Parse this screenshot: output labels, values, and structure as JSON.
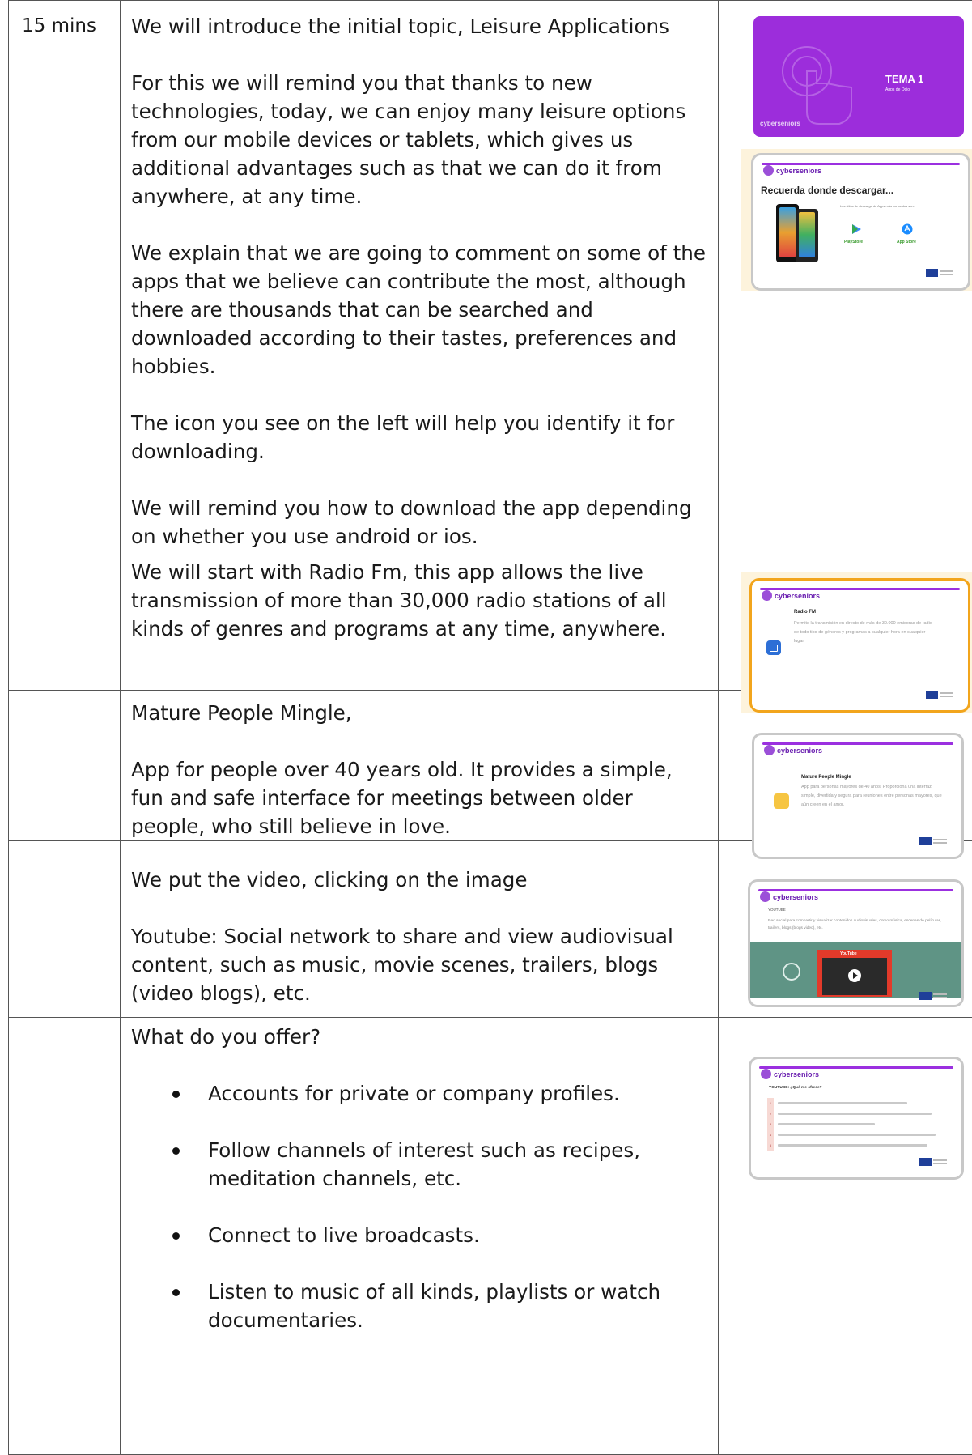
{
  "rows": [
    {
      "time": "15 mins",
      "paragraphs": [
        "We will introduce the initial topic, Leisure Applications",
        "For this we will remind you that thanks to new technologies, today, we can enjoy many leisure options from our mobile devices or tablets, which gives us additional advantages such as that we can do it from anywhere, at any time.",
        "We explain that we are going to comment on some of the apps that we believe can contribute the most, although there are thousands that can be searched and downloaded according to their tastes, preferences and hobbies.",
        "The icon you see on the left will help you identify it for downloading.",
        "We will remind you how to download the app depending on whether you use android or ios."
      ]
    },
    {
      "time": "",
      "paragraphs": [
        "We will start with Radio Fm, this app allows the live transmission of more than 30,000 radio stations of all kinds of genres and programs at any time, anywhere."
      ]
    },
    {
      "time": "",
      "paragraphs": [
        "Mature People Mingle,",
        "App for people over 40 years old. It provides a simple, fun and safe interface for meetings between older people, who still believe in love."
      ]
    },
    {
      "time": "",
      "paragraphs": [
        "We put the video, clicking on the image",
        "Youtube: Social network to share and view audiovisual content, such as music, movie scenes, trailers, blogs (video blogs), etc."
      ]
    },
    {
      "time": "",
      "intro": "What do you offer?",
      "bullets": [
        "Accounts for private or company profiles.",
        "Follow channels of interest such as recipes, meditation channels, etc.",
        "Connect to live broadcasts.",
        "Listen to music of all kinds, playlists or watch documentaries."
      ]
    }
  ],
  "slides": {
    "s1": {
      "title": "TEMA 1",
      "subtitle": "Apps de Ocio",
      "brand": "cyberseniors"
    },
    "s2": {
      "brand": "cyberseniors",
      "title": "Recuerda donde descargar...",
      "caption": "Los sitios de descarga de Apps más conocidos son:",
      "store1": "PlayStore",
      "store2": "App Store"
    },
    "s3": {
      "brand": "cyberseniors",
      "title": "Radio FM",
      "body": "Permite la transmisión en directo de más de 30.000 emisoras de radio de todo tipo de géneros y programas a cualquier hora en cualquier lugar."
    },
    "s4": {
      "brand": "cyberseniors",
      "title": "Mature People Mingle",
      "body": "App para personas mayores de 40 años. Proporciona una interfaz simple, divertida y segura para reuniones entre personas mayores, que aún creen en el amor."
    },
    "s5": {
      "brand": "cyberseniors",
      "tag": "YOUTUBE",
      "body": "Red social para compartir y visualizar contenidos audiovisuales, como música, escenas de películas, trailers, blogs (blogs video), etc.",
      "logo": "YouTube"
    },
    "s6": {
      "brand": "cyberseniors",
      "title": "YOUTUBE: ¿Qué me ofrece?",
      "items": [
        "1",
        "2",
        "3",
        "4",
        "5"
      ]
    }
  }
}
